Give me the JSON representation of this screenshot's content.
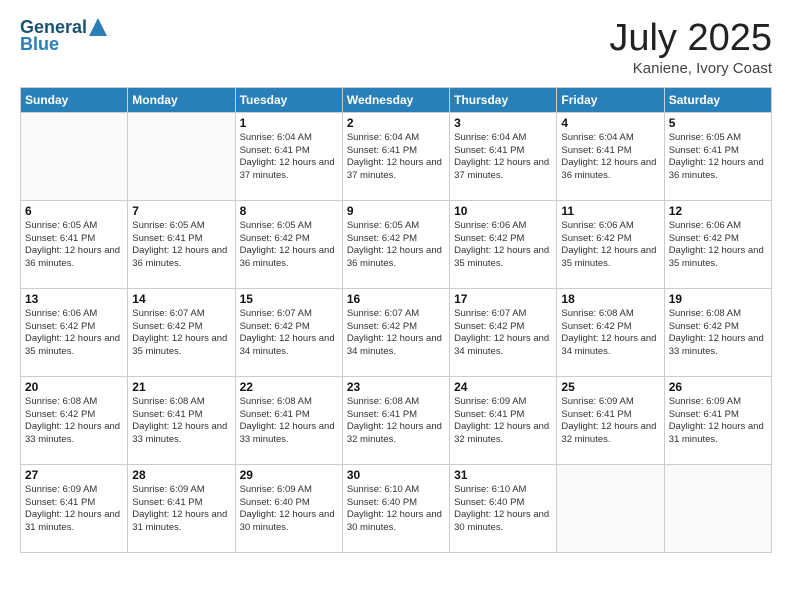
{
  "logo": {
    "line1": "General",
    "line2": "Blue"
  },
  "title": "July 2025",
  "location": "Kaniene, Ivory Coast",
  "days_of_week": [
    "Sunday",
    "Monday",
    "Tuesday",
    "Wednesday",
    "Thursday",
    "Friday",
    "Saturday"
  ],
  "weeks": [
    [
      {
        "day": "",
        "info": ""
      },
      {
        "day": "",
        "info": ""
      },
      {
        "day": "1",
        "info": "Sunrise: 6:04 AM\nSunset: 6:41 PM\nDaylight: 12 hours and 37 minutes."
      },
      {
        "day": "2",
        "info": "Sunrise: 6:04 AM\nSunset: 6:41 PM\nDaylight: 12 hours and 37 minutes."
      },
      {
        "day": "3",
        "info": "Sunrise: 6:04 AM\nSunset: 6:41 PM\nDaylight: 12 hours and 37 minutes."
      },
      {
        "day": "4",
        "info": "Sunrise: 6:04 AM\nSunset: 6:41 PM\nDaylight: 12 hours and 36 minutes."
      },
      {
        "day": "5",
        "info": "Sunrise: 6:05 AM\nSunset: 6:41 PM\nDaylight: 12 hours and 36 minutes."
      }
    ],
    [
      {
        "day": "6",
        "info": "Sunrise: 6:05 AM\nSunset: 6:41 PM\nDaylight: 12 hours and 36 minutes."
      },
      {
        "day": "7",
        "info": "Sunrise: 6:05 AM\nSunset: 6:41 PM\nDaylight: 12 hours and 36 minutes."
      },
      {
        "day": "8",
        "info": "Sunrise: 6:05 AM\nSunset: 6:42 PM\nDaylight: 12 hours and 36 minutes."
      },
      {
        "day": "9",
        "info": "Sunrise: 6:05 AM\nSunset: 6:42 PM\nDaylight: 12 hours and 36 minutes."
      },
      {
        "day": "10",
        "info": "Sunrise: 6:06 AM\nSunset: 6:42 PM\nDaylight: 12 hours and 35 minutes."
      },
      {
        "day": "11",
        "info": "Sunrise: 6:06 AM\nSunset: 6:42 PM\nDaylight: 12 hours and 35 minutes."
      },
      {
        "day": "12",
        "info": "Sunrise: 6:06 AM\nSunset: 6:42 PM\nDaylight: 12 hours and 35 minutes."
      }
    ],
    [
      {
        "day": "13",
        "info": "Sunrise: 6:06 AM\nSunset: 6:42 PM\nDaylight: 12 hours and 35 minutes."
      },
      {
        "day": "14",
        "info": "Sunrise: 6:07 AM\nSunset: 6:42 PM\nDaylight: 12 hours and 35 minutes."
      },
      {
        "day": "15",
        "info": "Sunrise: 6:07 AM\nSunset: 6:42 PM\nDaylight: 12 hours and 34 minutes."
      },
      {
        "day": "16",
        "info": "Sunrise: 6:07 AM\nSunset: 6:42 PM\nDaylight: 12 hours and 34 minutes."
      },
      {
        "day": "17",
        "info": "Sunrise: 6:07 AM\nSunset: 6:42 PM\nDaylight: 12 hours and 34 minutes."
      },
      {
        "day": "18",
        "info": "Sunrise: 6:08 AM\nSunset: 6:42 PM\nDaylight: 12 hours and 34 minutes."
      },
      {
        "day": "19",
        "info": "Sunrise: 6:08 AM\nSunset: 6:42 PM\nDaylight: 12 hours and 33 minutes."
      }
    ],
    [
      {
        "day": "20",
        "info": "Sunrise: 6:08 AM\nSunset: 6:42 PM\nDaylight: 12 hours and 33 minutes."
      },
      {
        "day": "21",
        "info": "Sunrise: 6:08 AM\nSunset: 6:41 PM\nDaylight: 12 hours and 33 minutes."
      },
      {
        "day": "22",
        "info": "Sunrise: 6:08 AM\nSunset: 6:41 PM\nDaylight: 12 hours and 33 minutes."
      },
      {
        "day": "23",
        "info": "Sunrise: 6:08 AM\nSunset: 6:41 PM\nDaylight: 12 hours and 32 minutes."
      },
      {
        "day": "24",
        "info": "Sunrise: 6:09 AM\nSunset: 6:41 PM\nDaylight: 12 hours and 32 minutes."
      },
      {
        "day": "25",
        "info": "Sunrise: 6:09 AM\nSunset: 6:41 PM\nDaylight: 12 hours and 32 minutes."
      },
      {
        "day": "26",
        "info": "Sunrise: 6:09 AM\nSunset: 6:41 PM\nDaylight: 12 hours and 31 minutes."
      }
    ],
    [
      {
        "day": "27",
        "info": "Sunrise: 6:09 AM\nSunset: 6:41 PM\nDaylight: 12 hours and 31 minutes."
      },
      {
        "day": "28",
        "info": "Sunrise: 6:09 AM\nSunset: 6:41 PM\nDaylight: 12 hours and 31 minutes."
      },
      {
        "day": "29",
        "info": "Sunrise: 6:09 AM\nSunset: 6:40 PM\nDaylight: 12 hours and 30 minutes."
      },
      {
        "day": "30",
        "info": "Sunrise: 6:10 AM\nSunset: 6:40 PM\nDaylight: 12 hours and 30 minutes."
      },
      {
        "day": "31",
        "info": "Sunrise: 6:10 AM\nSunset: 6:40 PM\nDaylight: 12 hours and 30 minutes."
      },
      {
        "day": "",
        "info": ""
      },
      {
        "day": "",
        "info": ""
      }
    ]
  ]
}
